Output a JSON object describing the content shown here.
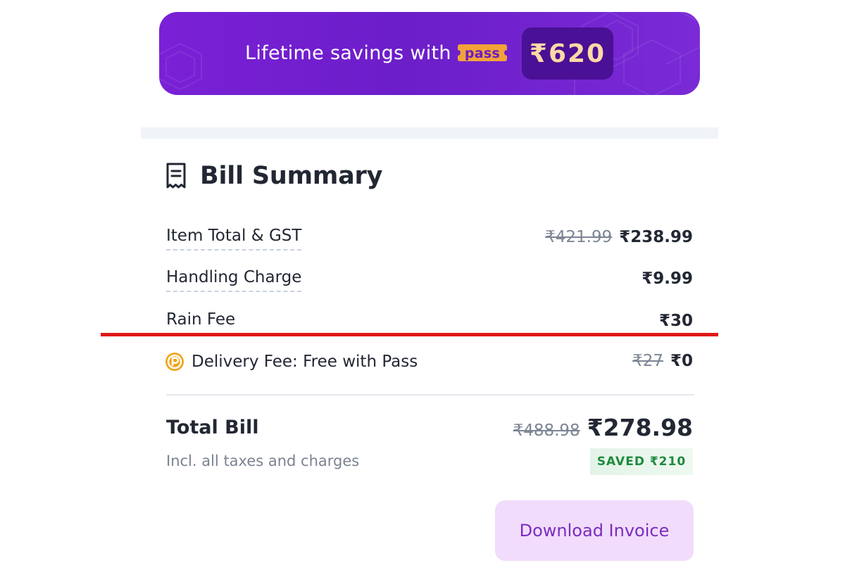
{
  "banner": {
    "text": "Lifetime savings with",
    "pass_logo_text": "pass",
    "savings_amount": "₹620",
    "colors": {
      "background": "#7a20d6",
      "chip": "#4a1095",
      "amount": "#ffd9a6",
      "logo": "#f2a33a"
    }
  },
  "bill": {
    "title": "Bill Summary",
    "rows": [
      {
        "label": "Item Total & GST",
        "original": "₹421.99",
        "value": "₹238.99"
      },
      {
        "label": "Handling Charge",
        "value": "₹9.99"
      },
      {
        "label": "Rain Fee",
        "value": "₹30"
      }
    ],
    "delivery": {
      "label": "Delivery Fee: Free with Pass",
      "original": "₹27",
      "value": "₹0"
    },
    "total": {
      "label": "Total Bill",
      "sublabel": "Incl. all taxes and charges",
      "original": "₹488.98",
      "value": "₹278.98",
      "saved": "SAVED ₹210"
    },
    "download_label": "Download Invoice"
  },
  "colors": {
    "accent": "#7b2cbf",
    "highlight_line": "#e01717",
    "saved_green": "#1f8a3e"
  },
  "icons": [
    "pass-logo-icon",
    "receipt-icon",
    "pass-p-icon"
  ]
}
